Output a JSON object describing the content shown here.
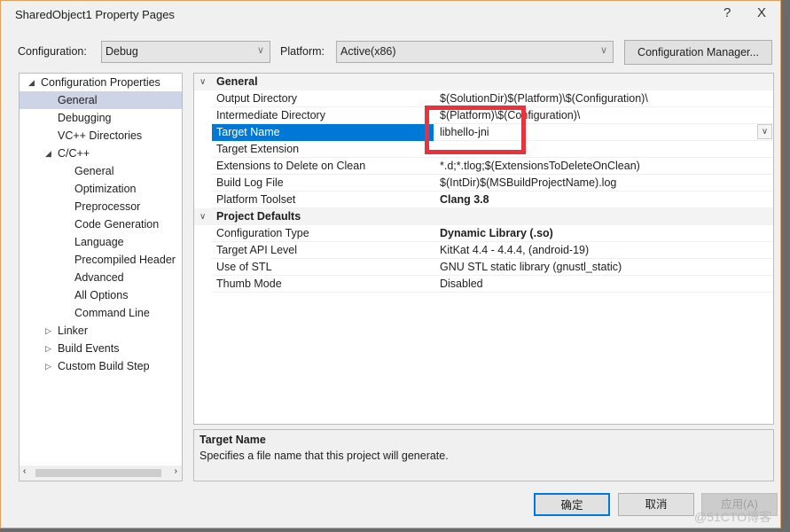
{
  "window": {
    "title": "SharedObject1 Property Pages",
    "help": "?",
    "close": "X"
  },
  "toolbar": {
    "configuration_label": "Configuration:",
    "configuration_value": "Debug",
    "platform_label": "Platform:",
    "platform_value": "Active(x86)",
    "config_manager": "Configuration Manager..."
  },
  "tree": [
    {
      "label": "Configuration Properties",
      "level": 0,
      "arrow": "◢",
      "selected": false
    },
    {
      "label": "General",
      "level": 1,
      "selected": true
    },
    {
      "label": "Debugging",
      "level": 1
    },
    {
      "label": "VC++ Directories",
      "level": 1
    },
    {
      "label": "C/C++",
      "level": 1,
      "arrow": "◢"
    },
    {
      "label": "General",
      "level": 2
    },
    {
      "label": "Optimization",
      "level": 2
    },
    {
      "label": "Preprocessor",
      "level": 2
    },
    {
      "label": "Code Generation",
      "level": 2
    },
    {
      "label": "Language",
      "level": 2
    },
    {
      "label": "Precompiled Header",
      "level": 2
    },
    {
      "label": "Advanced",
      "level": 2
    },
    {
      "label": "All Options",
      "level": 2
    },
    {
      "label": "Command Line",
      "level": 2
    },
    {
      "label": "Linker",
      "level": 1,
      "arrow": "▷"
    },
    {
      "label": "Build Events",
      "level": 1,
      "arrow": "▷"
    },
    {
      "label": "Custom Build Step",
      "level": 1,
      "arrow": "▷"
    }
  ],
  "sections": [
    {
      "title": "General",
      "rows": [
        {
          "key": "Output Directory",
          "value": "$(SolutionDir)$(Platform)\\$(Configuration)\\"
        },
        {
          "key": "Intermediate Directory",
          "value": "$(Platform)\\$(Configuration)\\"
        },
        {
          "key": "Target Name",
          "value": "libhello-jni",
          "selected": true
        },
        {
          "key": "Target Extension",
          "value": ""
        },
        {
          "key": "Extensions to Delete on Clean",
          "value": "*.d;*.tlog;$(ExtensionsToDeleteOnClean)"
        },
        {
          "key": "Build Log File",
          "value": "$(IntDir)$(MSBuildProjectName).log"
        },
        {
          "key": "Platform Toolset",
          "value": "Clang 3.8",
          "bold": true
        }
      ]
    },
    {
      "title": "Project Defaults",
      "rows": [
        {
          "key": "Configuration Type",
          "value": "Dynamic Library (.so)",
          "bold": true
        },
        {
          "key": "Target API Level",
          "value": "KitKat 4.4 - 4.4.4, (android-19)"
        },
        {
          "key": "Use of STL",
          "value": "GNU STL static library (gnustl_static)"
        },
        {
          "key": "Thumb Mode",
          "value": "Disabled"
        }
      ]
    }
  ],
  "description": {
    "title": "Target Name",
    "text": "Specifies a file name that this project will generate."
  },
  "buttons": {
    "ok": "确定",
    "cancel": "取消",
    "apply": "应用(A)"
  },
  "highlight_color": "#e8323c",
  "watermark": "@51CTO博客"
}
